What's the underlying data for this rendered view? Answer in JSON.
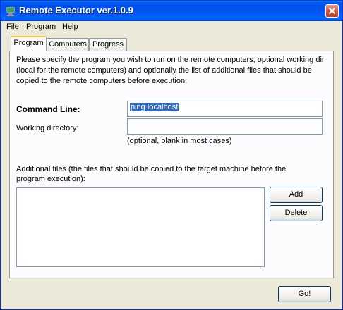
{
  "window": {
    "title": "Remote Executor ver.1.0.9"
  },
  "menu": {
    "items": [
      "File",
      "Program",
      "Help"
    ]
  },
  "tabs": [
    {
      "label": "Program",
      "active": true
    },
    {
      "label": "Computers"
    },
    {
      "label": "Progress"
    }
  ],
  "program": {
    "description": "Please specify the program you wish to run on the remote computers, optional working dir (local for the remote computers) and optionally the list of additional files that should be copied to the remote computers before execution:",
    "command_label": "Command Line:",
    "command_value": "ping localhost",
    "workdir_label": "Working directory:",
    "workdir_value": "",
    "workdir_hint": "(optional, blank in most cases)",
    "files_label": "Additional files (the files that should be copied to the target machine before the program execution):",
    "add_label": "Add",
    "delete_label": "Delete"
  },
  "footer": {
    "go_label": "Go!"
  },
  "colors": {
    "titlebar": "#0053ee",
    "face": "#ece9d8",
    "selection": "#316ac5",
    "close": "#c03b1e"
  },
  "icons": {
    "app": "computer-icon",
    "close": "close-icon"
  }
}
